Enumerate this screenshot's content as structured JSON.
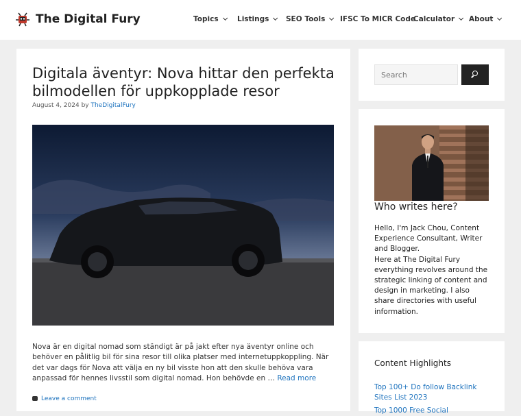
{
  "site": {
    "title": "The Digital Fury"
  },
  "nav": [
    {
      "label": "Topics",
      "has_dropdown": true
    },
    {
      "label": "Listings",
      "has_dropdown": true
    },
    {
      "label": "SEO Tools",
      "has_dropdown": true
    },
    {
      "label": "IFSC To MICR Code",
      "has_dropdown": false
    },
    {
      "label": "Calculator",
      "has_dropdown": true
    },
    {
      "label": "About",
      "has_dropdown": true
    }
  ],
  "post": {
    "title": "Digitala äventyr: Nova hittar den perfekta bilmodellen för uppkopplade resor",
    "date": "August 4, 2024",
    "by": "by",
    "author": "TheDigitalFury",
    "excerpt": "Nova är en digital nomad som ständigt är på jakt efter nya äventyr online och behöver en pålitlig bil för sina resor till olika platser med internetuppkoppling. När det var dags för Nova att välja en ny bil visste hon att den skulle behöva vara anpassad för hennes livsstil som digital nomad. Hon behövde en …",
    "read_more": "Read more",
    "comment_link": "Leave a comment"
  },
  "sidebar": {
    "search": {
      "placeholder": "Search"
    },
    "author_widget": {
      "heading": "Who writes here?",
      "bio": "Hello, I'm Jack Chou, Content Experience Consultant, Writer and Blogger.\nHere at The Digital Fury everything revolves around the strategic linking of content and design in marketing. I also share directories with useful information."
    },
    "highlights": {
      "heading": "Content Highlights",
      "links": [
        "Top 100+ Do follow Backlink Sites List 2023",
        "Top 1000 Free Social"
      ]
    }
  },
  "icons": {
    "logo": "robot-bug-icon",
    "search": "search-icon",
    "chevron": "chevron-down-icon",
    "comment": "comment-icon"
  },
  "colors": {
    "link": "#1e73be",
    "header_bg": "#ffffff",
    "page_bg": "#efefef",
    "search_button": "#222222"
  }
}
